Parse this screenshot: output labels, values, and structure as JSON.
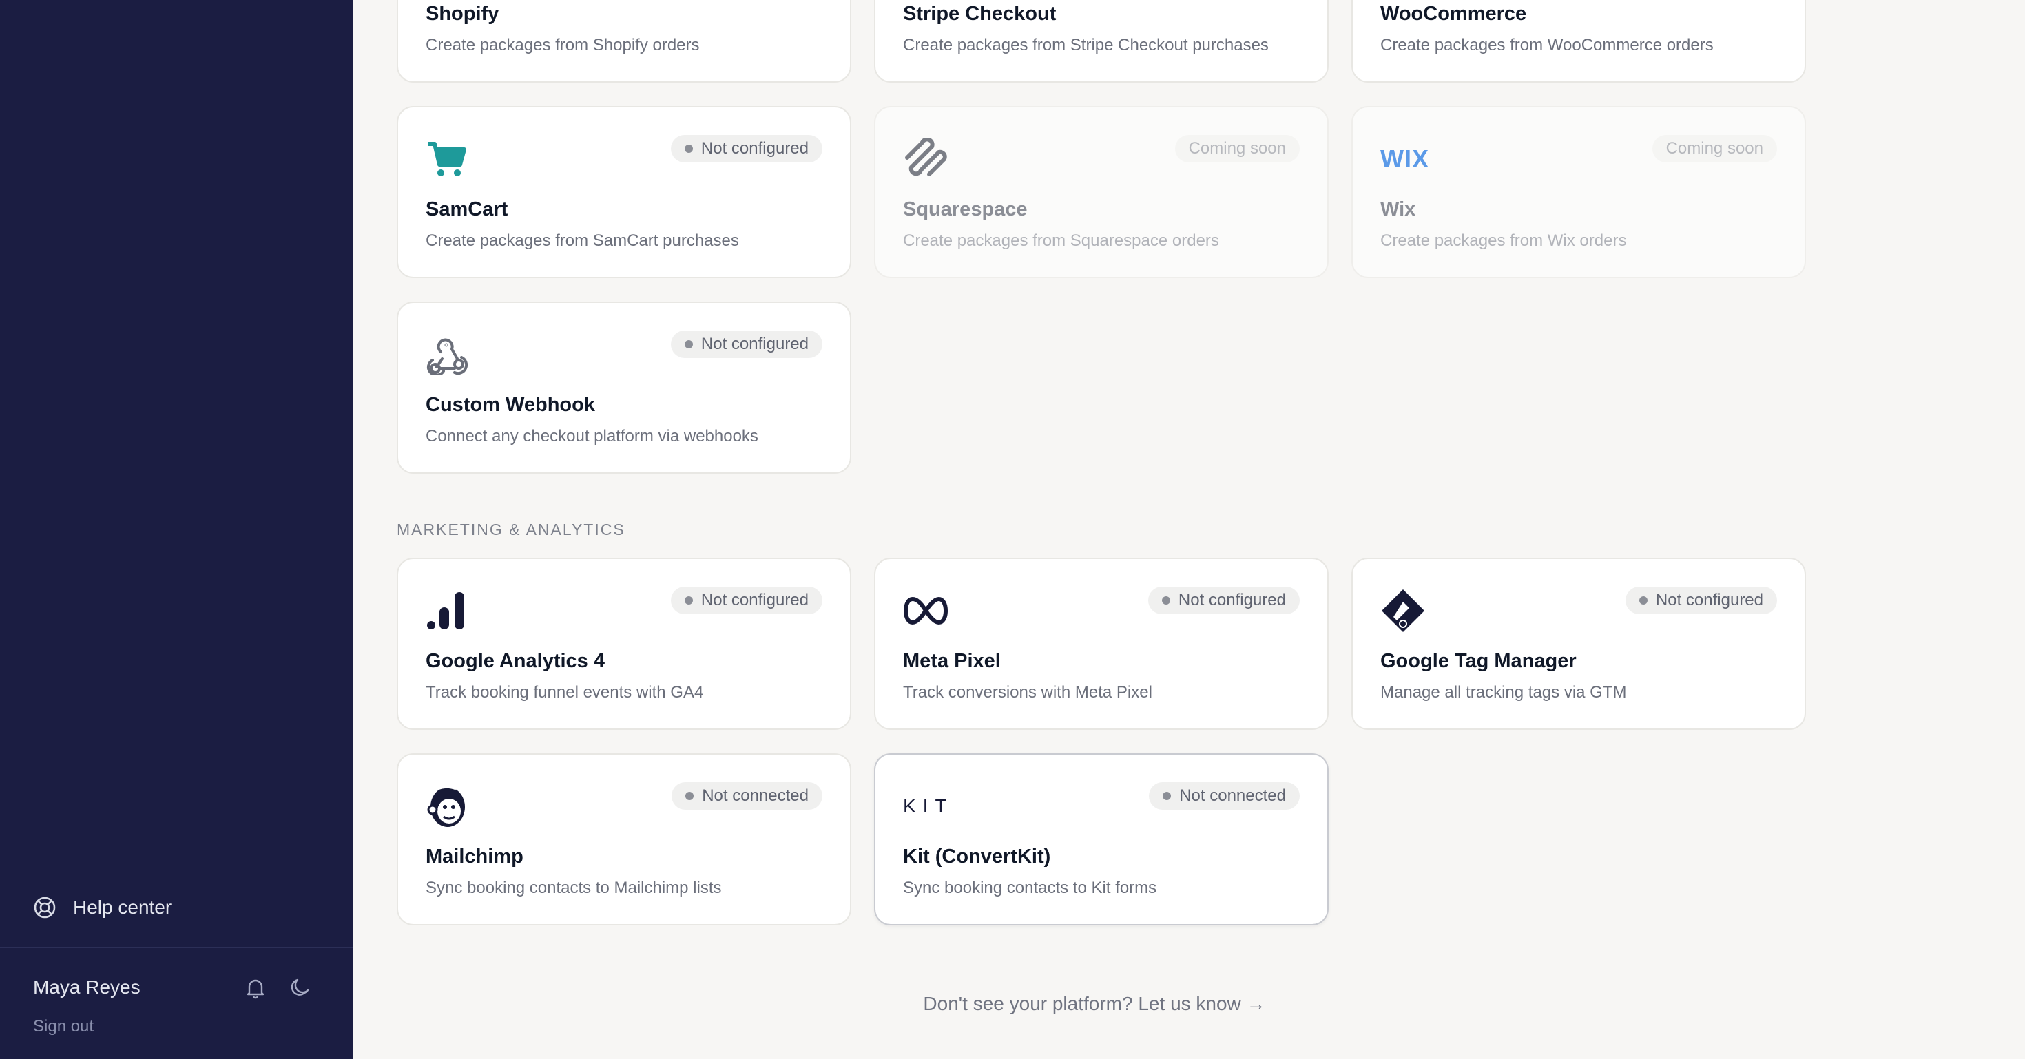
{
  "sidebar": {
    "help_label": "Help center",
    "user_name": "Maya Reyes",
    "sign_out": "Sign out"
  },
  "ecommerce": [
    {
      "name": "Shopify",
      "desc": "Create packages from Shopify orders"
    },
    {
      "name": "Stripe Checkout",
      "desc": "Create packages from Stripe Checkout purchases"
    },
    {
      "name": "WooCommerce",
      "desc": "Create packages from WooCommerce orders"
    },
    {
      "name": "SamCart",
      "desc": "Create packages from SamCart purchases",
      "status": "Not configured",
      "icon": "cart-icon"
    },
    {
      "name": "Squarespace",
      "desc": "Create packages from Squarespace orders",
      "status": "Coming soon",
      "icon": "squarespace-icon"
    },
    {
      "name": "Wix",
      "desc": "Create packages from Wix orders",
      "status": "Coming soon",
      "icon": "wix-icon",
      "logo_text": "WIX"
    },
    {
      "name": "Custom Webhook",
      "desc": "Connect any checkout platform via webhooks",
      "status": "Not configured",
      "icon": "webhook-icon"
    }
  ],
  "marketing": {
    "section_title": "MARKETING & ANALYTICS",
    "items": [
      {
        "name": "Google Analytics 4",
        "desc": "Track booking funnel events with GA4",
        "status": "Not configured",
        "icon": "google-analytics-icon"
      },
      {
        "name": "Meta Pixel",
        "desc": "Track conversions with Meta Pixel",
        "status": "Not configured",
        "icon": "meta-icon"
      },
      {
        "name": "Google Tag Manager",
        "desc": "Manage all tracking tags via GTM",
        "status": "Not configured",
        "icon": "gtm-icon"
      },
      {
        "name": "Mailchimp",
        "desc": "Sync booking contacts to Mailchimp lists",
        "status": "Not connected",
        "icon": "mailchimp-icon"
      },
      {
        "name": "Kit (ConvertKit)",
        "desc": "Sync booking contacts to Kit forms",
        "status": "Not connected",
        "icon": "kit-icon",
        "logo_text": "KIT"
      }
    ]
  },
  "footer_link": "Don't see your platform? Let us know →",
  "colors": {
    "sidebar_bg": "#1b1d42",
    "page_bg": "#f7f6f4",
    "samcart_teal": "#1e9a9a",
    "wix_blue": "#5b9ae8"
  }
}
